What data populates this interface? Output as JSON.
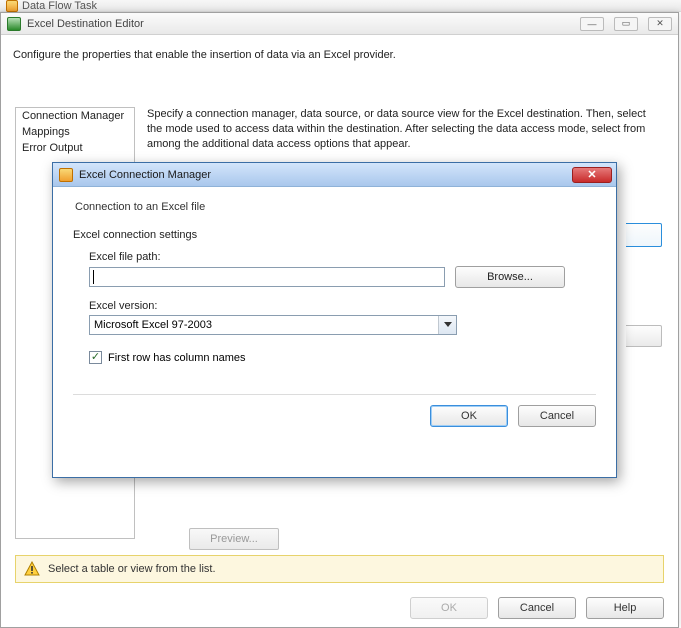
{
  "parent_title": "Data Flow Task",
  "main": {
    "title": "Excel Destination Editor",
    "intro": "Configure the properties that enable the insertion of data via an Excel provider.",
    "nav": [
      "Connection Manager",
      "Mappings",
      "Error Output"
    ],
    "desc": "Specify a connection manager, data source, or data source view for the Excel destination. Then, select the mode used to access data within the destination. After selecting the data access mode, select from among the additional data access options that appear.",
    "preview": "Preview...",
    "warn": "Select a table or view from the list.",
    "buttons": {
      "ok": "OK",
      "cancel": "Cancel",
      "help": "Help"
    }
  },
  "modal": {
    "title": "Excel Connection Manager",
    "subtitle": "Connection to an Excel file",
    "section": "Excel connection settings",
    "path_label": "Excel file path:",
    "path_value": "",
    "browse": "Browse...",
    "version_label": "Excel version:",
    "version_value": "Microsoft Excel 97-2003",
    "firstrow_label": "First row has column names",
    "firstrow_checked": true,
    "buttons": {
      "ok": "OK",
      "cancel": "Cancel"
    }
  }
}
